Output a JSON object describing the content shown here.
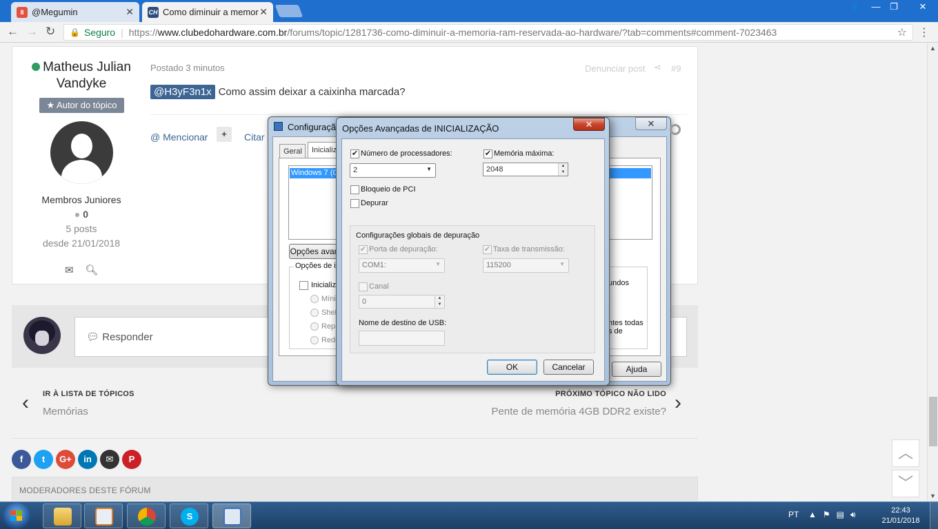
{
  "browser": {
    "tabs": [
      {
        "title": "@Megumin",
        "favicon_badge": "8",
        "favicon_color": "#e1523d"
      },
      {
        "title": "Como diminuir a memor",
        "favicon_text": "CH",
        "favicon_color": "#2b4c7e"
      }
    ],
    "secure_label": "Seguro",
    "url_scheme": "https://",
    "url_host": "www.clubedohardware.com.br",
    "url_path": "/forums/topic/1281736-como-diminuir-a-memoria-ram-reservada-ao-hardware/?tab=comments#comment-7023463"
  },
  "post": {
    "author_name": "Matheus Julian Vandyke",
    "author_badge": "Autor do tópico",
    "rank": "Membros Juniores",
    "reputation": "0",
    "posts": "5 posts",
    "since": "desde 21/01/2018",
    "posted": "Postado 3 minutos",
    "report": "Denunciar post",
    "number": "#9",
    "mention_tag": "@H3yF3n1x",
    "content": "Como assim deixar a caixinha marcada?",
    "mention_btn": "@ Mencionar",
    "plus_btn": "+",
    "quote_btn": "Citar"
  },
  "reply": {
    "placeholder": "Responder"
  },
  "topic_nav": {
    "prev_label": "IR À LISTA DE TÓPICOS",
    "prev_title": "Memórias",
    "next_label": "PRÓXIMO TÓPICO NÃO LIDO",
    "next_title": "Pente de memória 4GB DDR2 existe?"
  },
  "social": [
    {
      "name": "facebook",
      "glyph": "f",
      "color": "#3b5998"
    },
    {
      "name": "twitter",
      "glyph": "t",
      "color": "#1da1f2"
    },
    {
      "name": "google-plus",
      "glyph": "G+",
      "color": "#dd4b39"
    },
    {
      "name": "linkedin",
      "glyph": "in",
      "color": "#0077b5"
    },
    {
      "name": "email",
      "glyph": "✉",
      "color": "#333333"
    },
    {
      "name": "pinterest",
      "glyph": "P",
      "color": "#cb2027"
    }
  ],
  "moderators_label": "MODERADORES DESTE FÓRUM",
  "msconfig": {
    "title": "Configuraçã",
    "tabs": [
      "Geral",
      "Inicializ"
    ],
    "boot_entry": "Windows 7 (C",
    "advanced_btn": "Opções avan",
    "boot_options_label": "Opções de in",
    "safe_boot_label": "Inicializ",
    "radio_items": [
      "Mínim",
      "Shell",
      "Repa",
      "Rede"
    ],
    "right_text_1": "undos",
    "right_text_2": "ntes todas",
    "right_text_3": "s de",
    "help_btn": "Ajuda"
  },
  "advanced": {
    "title": "Opções Avançadas de INICIALIZAÇÃO",
    "num_processors_label": "Número de processadores:",
    "num_processors_checked": true,
    "num_processors_value": "2",
    "max_memory_label": "Memória máxima:",
    "max_memory_checked": true,
    "max_memory_value": "2048",
    "pci_lock_label": "Bloqueio de PCI",
    "debug_label": "Depurar",
    "global_debug_label": "Configurações globais de depuração",
    "debug_port_label": "Porta de depuração:",
    "debug_port_value": "COM1:",
    "baud_rate_label": "Taxa de transmissão:",
    "baud_rate_value": "115200",
    "channel_label": "Canal",
    "channel_value": "0",
    "usb_target_label": "Nome de destino de USB:",
    "usb_target_value": "",
    "ok_btn": "OK",
    "cancel_btn": "Cancelar"
  },
  "taskbar": {
    "language": "PT",
    "time": "22:43",
    "date": "21/01/2018"
  }
}
